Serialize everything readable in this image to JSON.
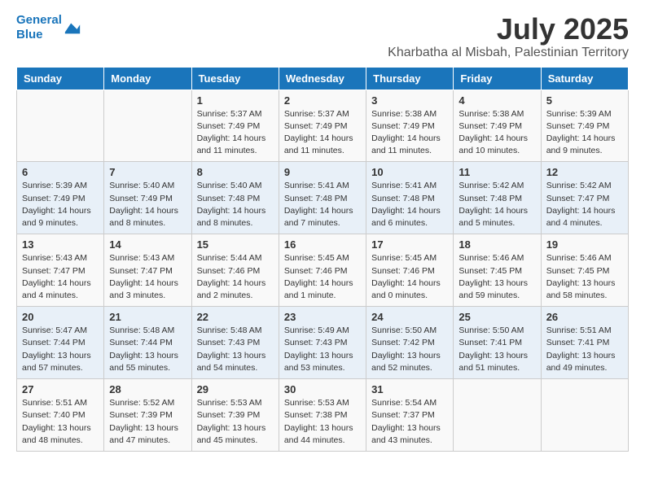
{
  "header": {
    "logo_line1": "General",
    "logo_line2": "Blue",
    "month": "July 2025",
    "location": "Kharbatha al Misbah, Palestinian Territory"
  },
  "weekdays": [
    "Sunday",
    "Monday",
    "Tuesday",
    "Wednesday",
    "Thursday",
    "Friday",
    "Saturday"
  ],
  "weeks": [
    [
      {
        "day": "",
        "info": ""
      },
      {
        "day": "",
        "info": ""
      },
      {
        "day": "1",
        "info": "Sunrise: 5:37 AM\nSunset: 7:49 PM\nDaylight: 14 hours\nand 11 minutes."
      },
      {
        "day": "2",
        "info": "Sunrise: 5:37 AM\nSunset: 7:49 PM\nDaylight: 14 hours\nand 11 minutes."
      },
      {
        "day": "3",
        "info": "Sunrise: 5:38 AM\nSunset: 7:49 PM\nDaylight: 14 hours\nand 11 minutes."
      },
      {
        "day": "4",
        "info": "Sunrise: 5:38 AM\nSunset: 7:49 PM\nDaylight: 14 hours\nand 10 minutes."
      },
      {
        "day": "5",
        "info": "Sunrise: 5:39 AM\nSunset: 7:49 PM\nDaylight: 14 hours\nand 9 minutes."
      }
    ],
    [
      {
        "day": "6",
        "info": "Sunrise: 5:39 AM\nSunset: 7:49 PM\nDaylight: 14 hours\nand 9 minutes."
      },
      {
        "day": "7",
        "info": "Sunrise: 5:40 AM\nSunset: 7:49 PM\nDaylight: 14 hours\nand 8 minutes."
      },
      {
        "day": "8",
        "info": "Sunrise: 5:40 AM\nSunset: 7:48 PM\nDaylight: 14 hours\nand 8 minutes."
      },
      {
        "day": "9",
        "info": "Sunrise: 5:41 AM\nSunset: 7:48 PM\nDaylight: 14 hours\nand 7 minutes."
      },
      {
        "day": "10",
        "info": "Sunrise: 5:41 AM\nSunset: 7:48 PM\nDaylight: 14 hours\nand 6 minutes."
      },
      {
        "day": "11",
        "info": "Sunrise: 5:42 AM\nSunset: 7:48 PM\nDaylight: 14 hours\nand 5 minutes."
      },
      {
        "day": "12",
        "info": "Sunrise: 5:42 AM\nSunset: 7:47 PM\nDaylight: 14 hours\nand 4 minutes."
      }
    ],
    [
      {
        "day": "13",
        "info": "Sunrise: 5:43 AM\nSunset: 7:47 PM\nDaylight: 14 hours\nand 4 minutes."
      },
      {
        "day": "14",
        "info": "Sunrise: 5:43 AM\nSunset: 7:47 PM\nDaylight: 14 hours\nand 3 minutes."
      },
      {
        "day": "15",
        "info": "Sunrise: 5:44 AM\nSunset: 7:46 PM\nDaylight: 14 hours\nand 2 minutes."
      },
      {
        "day": "16",
        "info": "Sunrise: 5:45 AM\nSunset: 7:46 PM\nDaylight: 14 hours\nand 1 minute."
      },
      {
        "day": "17",
        "info": "Sunrise: 5:45 AM\nSunset: 7:46 PM\nDaylight: 14 hours\nand 0 minutes."
      },
      {
        "day": "18",
        "info": "Sunrise: 5:46 AM\nSunset: 7:45 PM\nDaylight: 13 hours\nand 59 minutes."
      },
      {
        "day": "19",
        "info": "Sunrise: 5:46 AM\nSunset: 7:45 PM\nDaylight: 13 hours\nand 58 minutes."
      }
    ],
    [
      {
        "day": "20",
        "info": "Sunrise: 5:47 AM\nSunset: 7:44 PM\nDaylight: 13 hours\nand 57 minutes."
      },
      {
        "day": "21",
        "info": "Sunrise: 5:48 AM\nSunset: 7:44 PM\nDaylight: 13 hours\nand 55 minutes."
      },
      {
        "day": "22",
        "info": "Sunrise: 5:48 AM\nSunset: 7:43 PM\nDaylight: 13 hours\nand 54 minutes."
      },
      {
        "day": "23",
        "info": "Sunrise: 5:49 AM\nSunset: 7:43 PM\nDaylight: 13 hours\nand 53 minutes."
      },
      {
        "day": "24",
        "info": "Sunrise: 5:50 AM\nSunset: 7:42 PM\nDaylight: 13 hours\nand 52 minutes."
      },
      {
        "day": "25",
        "info": "Sunrise: 5:50 AM\nSunset: 7:41 PM\nDaylight: 13 hours\nand 51 minutes."
      },
      {
        "day": "26",
        "info": "Sunrise: 5:51 AM\nSunset: 7:41 PM\nDaylight: 13 hours\nand 49 minutes."
      }
    ],
    [
      {
        "day": "27",
        "info": "Sunrise: 5:51 AM\nSunset: 7:40 PM\nDaylight: 13 hours\nand 48 minutes."
      },
      {
        "day": "28",
        "info": "Sunrise: 5:52 AM\nSunset: 7:39 PM\nDaylight: 13 hours\nand 47 minutes."
      },
      {
        "day": "29",
        "info": "Sunrise: 5:53 AM\nSunset: 7:39 PM\nDaylight: 13 hours\nand 45 minutes."
      },
      {
        "day": "30",
        "info": "Sunrise: 5:53 AM\nSunset: 7:38 PM\nDaylight: 13 hours\nand 44 minutes."
      },
      {
        "day": "31",
        "info": "Sunrise: 5:54 AM\nSunset: 7:37 PM\nDaylight: 13 hours\nand 43 minutes."
      },
      {
        "day": "",
        "info": ""
      },
      {
        "day": "",
        "info": ""
      }
    ]
  ]
}
